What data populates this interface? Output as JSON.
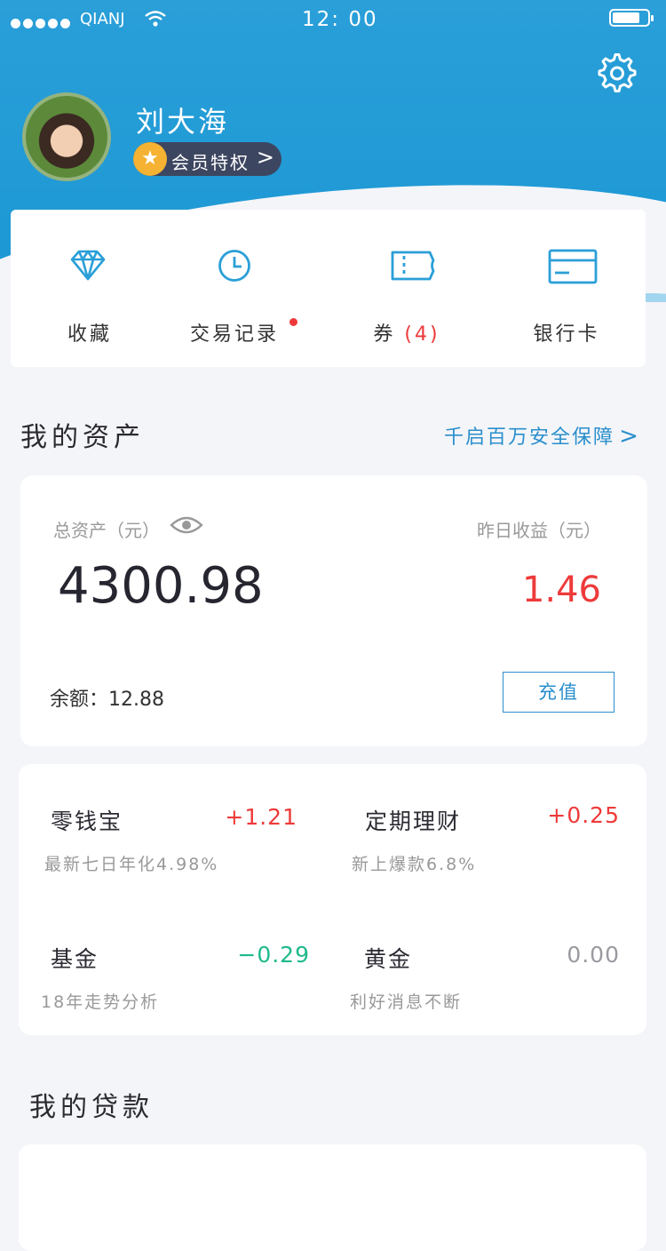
{
  "status_bar": {
    "carrier": "QIANJ",
    "time": "12: 00"
  },
  "profile": {
    "name": "刘大海",
    "vip_label": "会员特权"
  },
  "quick_actions": [
    {
      "label": "收藏",
      "icon": "diamond-icon"
    },
    {
      "label": "交易记录",
      "icon": "clock-icon",
      "has_dot": true
    },
    {
      "label": "券",
      "count": "(4)",
      "icon": "ticket-icon"
    },
    {
      "label": "银行卡",
      "icon": "bank-card-icon"
    }
  ],
  "assets_section": {
    "title": "我的资产",
    "link": "千启百万安全保障"
  },
  "assets": {
    "total_label": "总资产（元）",
    "total_value": "4300.98",
    "yesterday_label": "昨日收益（元）",
    "yesterday_value": "1.46",
    "balance_label": "余额：",
    "balance_value": "12.88",
    "recharge_label": "充值"
  },
  "products": [
    {
      "name": "零钱宝",
      "value": "+1.21",
      "sub": "最新七日年化4.98%"
    },
    {
      "name": "定期理财",
      "value": "+0.25",
      "sub": "新上爆款6.8%"
    },
    {
      "name": "基金",
      "value": "−0.29",
      "sub": "18年走势分析"
    },
    {
      "name": "黄金",
      "value": "0.00",
      "sub": "利好消息不断"
    }
  ],
  "loans_section": {
    "title": "我的贷款"
  },
  "colors": {
    "brand": "#1b97d4",
    "positive": "#ee3a3a",
    "negative": "#1fb98c",
    "link": "#2a8fcc"
  }
}
